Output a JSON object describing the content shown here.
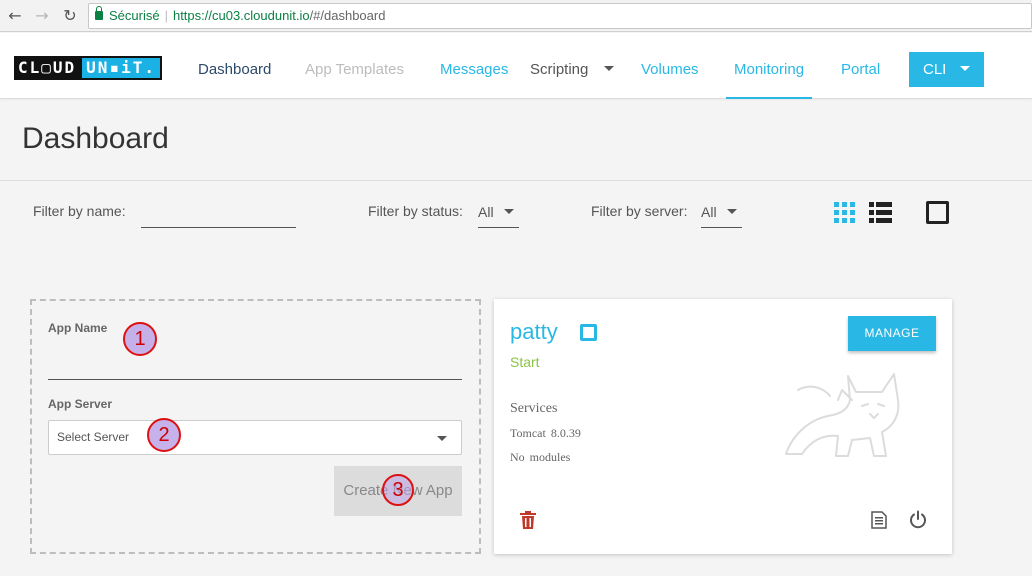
{
  "browser": {
    "secure_label": "Sécurisé",
    "url_domain": "https://cu03.cloudunit.io",
    "url_rest": "/#/dashboard"
  },
  "brand": {
    "logo_part1": "CL▢UD",
    "logo_part2": "UN▪iT."
  },
  "nav": {
    "dashboard": "Dashboard",
    "app_templates": "App Templates",
    "messages": "Messages",
    "scripting": "Scripting",
    "volumes": "Volumes",
    "monitoring": "Monitoring",
    "portal": "Portal",
    "cli": "CLI"
  },
  "page": {
    "title": "Dashboard"
  },
  "filters": {
    "name_label": "Filter by name:",
    "status_label": "Filter by status:",
    "status_value": "All",
    "server_label": "Filter by server:",
    "server_value": "All"
  },
  "create_form": {
    "app_name_label": "App Name",
    "app_server_label": "App Server",
    "server_placeholder": "Select Server",
    "create_label": "Create New App",
    "marker1": "1",
    "marker2": "2",
    "marker3": "3"
  },
  "app_card": {
    "name": "patty",
    "status": "Start",
    "manage_label": "MANAGE",
    "services_label": "Services",
    "service_server": "Tomcat 8.0.39",
    "service_modules": "No modules"
  },
  "colors": {
    "accent": "#29b8e5",
    "status_start": "#8bc34a",
    "danger": "#c0392b"
  }
}
